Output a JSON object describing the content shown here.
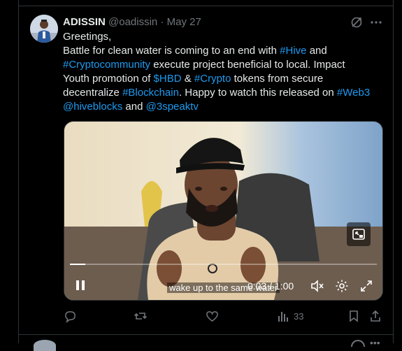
{
  "tweet": {
    "display_name": "ADISSIN",
    "handle": "@oadissin",
    "separator": " · ",
    "date": "May 27",
    "text": {
      "greeting": "Greetings,",
      "s1": "Battle for clean water is coming to an end with ",
      "hive": "#Hive",
      "s2": " and ",
      "cryptocommunity": "#Cryptocommunity",
      "s3": " execute project beneficial to local. Impact Youth promotion of ",
      "hbd": "$HBD",
      "s4": " & ",
      "crypto": "#Crypto",
      "s5": " tokens from secure decentralize ",
      "blockchain": "#Blockchain",
      "s6": ". Happy to watch this released on ",
      "web3": "#Web3",
      "s7": " ",
      "hiveblocks": "@hiveblocks",
      "s8": " and ",
      "threespeak": "@3speaktv"
    }
  },
  "video": {
    "current_time": "0:03",
    "time_separator": " / ",
    "duration": "1:00",
    "progress_fraction": 0.05,
    "caption": "wake up to the same water"
  },
  "actions": {
    "reply_count": "",
    "retweet_count": "",
    "like_count": "",
    "views_count": "33"
  },
  "colors": {
    "accent": "#1d9bf0",
    "muted": "#71767b",
    "text": "#e7e9ea",
    "background": "#000000",
    "border": "#2f3336"
  },
  "icons": [
    "grok-icon",
    "more-icon",
    "pip-icon",
    "pause-icon",
    "mute-icon",
    "settings-icon",
    "fullscreen-icon",
    "reply-icon",
    "retweet-icon",
    "like-icon",
    "views-icon",
    "bookmark-icon",
    "share-icon"
  ]
}
